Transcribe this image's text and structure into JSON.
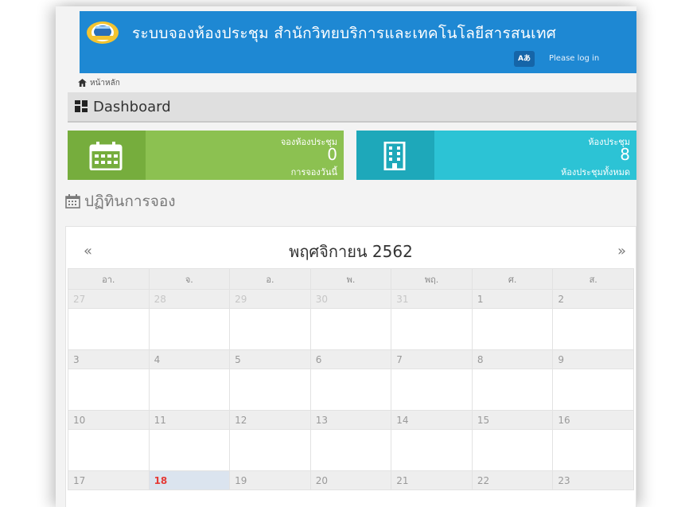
{
  "header": {
    "title": "ระบบจองห้องประชุม สำนักวิทยบริการและเทคโนโลยีสารสนเทศ",
    "lang_label": "Aあ",
    "login_label": "Please log in"
  },
  "breadcrumb": {
    "home_label": "หน้าหลัก"
  },
  "dashboard": {
    "title": "Dashboard"
  },
  "cards": {
    "booking": {
      "label": "จองห้องประชุม",
      "value": "0",
      "sub": "การจองวันนี้",
      "color": "#8cc151",
      "icon": "calendar-icon"
    },
    "rooms": {
      "label": "ห้องประชุม",
      "value": "8",
      "sub": "ห้องประชุมทั้งหมด",
      "color": "#2cc3d5",
      "icon": "building-icon"
    }
  },
  "calendar": {
    "heading": "ปฏิทินการจอง",
    "prev_label": "«",
    "next_label": "»",
    "month_label": "พฤศจิกายน 2562",
    "weekdays": [
      "อา.",
      "จ.",
      "อ.",
      "พ.",
      "พฤ.",
      "ศ.",
      "ส."
    ],
    "weeks": [
      [
        "27",
        "28",
        "29",
        "30",
        "31",
        "1",
        "2"
      ],
      [
        "3",
        "4",
        "5",
        "6",
        "7",
        "8",
        "9"
      ],
      [
        "10",
        "11",
        "12",
        "13",
        "14",
        "15",
        "16"
      ],
      [
        "17",
        "18",
        "19",
        "20",
        "21",
        "22",
        "23"
      ]
    ],
    "today": "18",
    "accent_color": "#1e88d3"
  }
}
